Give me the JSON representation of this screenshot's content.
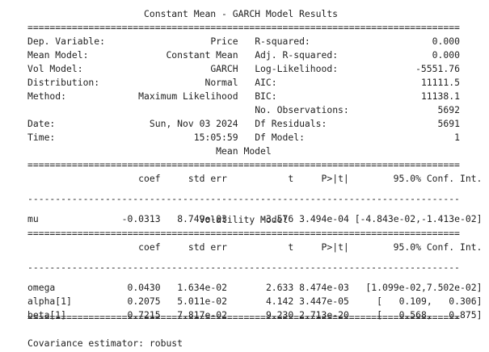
{
  "title": "Constant Mean - GARCH Model Results",
  "sep_eq": "==============================================================================",
  "sep_dash": "------------------------------------------------------------------------------",
  "header_rows": [
    {
      "left_label": "Dep. Variable:",
      "left_value": "Price",
      "right_label": "R-squared:",
      "right_value": "0.000"
    },
    {
      "left_label": "Mean Model:",
      "left_value": "Constant Mean",
      "right_label": "Adj. R-squared:",
      "right_value": "0.000"
    },
    {
      "left_label": "Vol Model:",
      "left_value": "GARCH",
      "right_label": "Log-Likelihood:",
      "right_value": "-5551.76"
    },
    {
      "left_label": "Distribution:",
      "left_value": "Normal",
      "right_label": "AIC:",
      "right_value": "11111.5"
    },
    {
      "left_label": "Method:",
      "left_value": "Maximum Likelihood",
      "right_label": "BIC:",
      "right_value": "11138.1"
    },
    {
      "left_label": "",
      "left_value": "",
      "right_label": "No. Observations:",
      "right_value": "5692"
    },
    {
      "left_label": "Date:",
      "left_value": "Sun, Nov 03 2024",
      "right_label": "Df Residuals:",
      "right_value": "5691"
    },
    {
      "left_label": "Time:",
      "left_value": "15:05:59",
      "right_label": "Df Model:",
      "right_value": "1"
    }
  ],
  "mean_model": {
    "title": "Mean Model",
    "columns": [
      "coef",
      "std err",
      "t",
      "P>|t|",
      "95.0% Conf. Int."
    ],
    "rows": [
      {
        "name": "mu",
        "coef": "-0.0313",
        "std_err": "8.749e-03",
        "t": "-3.576",
        "p": "3.494e-04",
        "ci": "[-4.843e-02,-1.413e-02]"
      }
    ]
  },
  "volatility_model": {
    "title": "Volatility Model",
    "columns": [
      "coef",
      "std err",
      "t",
      "P>|t|",
      "95.0% Conf. Int."
    ],
    "rows": [
      {
        "name": "omega",
        "coef": "0.0430",
        "std_err": "1.634e-02",
        "t": "2.633",
        "p": "8.474e-03",
        "ci": "[1.099e-02,7.502e-02]"
      },
      {
        "name": "alpha[1]",
        "coef": "0.2075",
        "std_err": "5.011e-02",
        "t": "4.142",
        "p": "3.447e-05",
        "ci": "[   0.109,   0.306]"
      },
      {
        "name": "beta[1]",
        "coef": "0.7215",
        "std_err": "7.817e-02",
        "t": "9.230",
        "p": "2.713e-20",
        "ci": "[   0.568,   0.875]"
      }
    ]
  },
  "footer": "Covariance estimator: robust"
}
